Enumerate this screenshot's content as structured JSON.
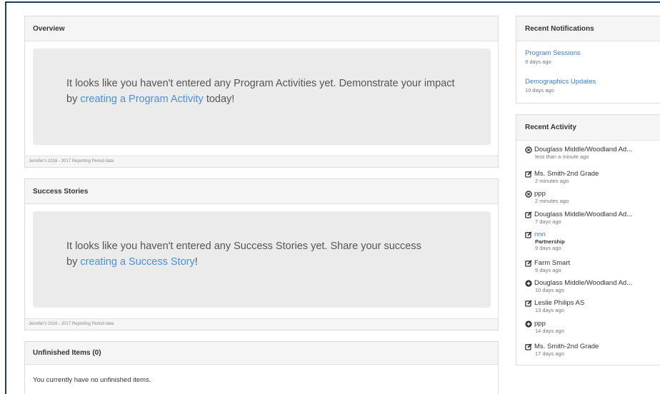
{
  "overview": {
    "title": "Overview",
    "empty_prefix": "It looks like you haven't entered any Program Activities yet. Demonstrate your impact by ",
    "empty_link": "creating a Program Activity",
    "empty_suffix": " today!",
    "footer": "Jennifer's 2016 - 2017 Reporting Period data"
  },
  "success": {
    "title": "Success Stories",
    "empty_prefix": "It looks like you haven't entered any Success Stories yet. Share your success by ",
    "empty_link": "creating a Success Story",
    "empty_suffix": "!",
    "footer": "Jennifer's 2016 - 2017 Reporting Period data"
  },
  "unfinished": {
    "title": "Unfinished Items (0)",
    "message": "You currently have no unfinished items."
  },
  "notifications": {
    "title": "Recent Notifications",
    "items": [
      {
        "title": "Program Sessions",
        "time": "9 days ago"
      },
      {
        "title": "Demographics Updates",
        "time": "10 days ago"
      }
    ]
  },
  "activity": {
    "title": "Recent Activity",
    "items": [
      {
        "icon": "circle-x-icon",
        "label": "Douglass Middle/Woodland Ad...",
        "time": "less than a minute ago"
      },
      {
        "icon": "edit-icon",
        "label": "Ms. Smith-2nd Grade",
        "time": "2 minutes ago"
      },
      {
        "icon": "circle-x-icon",
        "label": "ppp",
        "time": "2 minutes ago"
      },
      {
        "icon": "edit-icon",
        "label": "Douglass Middle/Woodland Ad...",
        "time": "7 days ago"
      },
      {
        "icon": "edit-icon",
        "label": "nnn",
        "sub": "Partnership",
        "time": "9 days ago"
      },
      {
        "icon": "edit-icon",
        "label": "Farm Smart",
        "time": "9 days ago"
      },
      {
        "icon": "plus-circle-icon",
        "label": "Douglass Middle/Woodland Ad...",
        "time": "10 days ago"
      },
      {
        "icon": "edit-icon",
        "label": "Leslie Philips AS",
        "time": "13 days ago"
      },
      {
        "icon": "plus-circle-icon",
        "label": "ppp",
        "time": "14 days ago"
      },
      {
        "icon": "edit-icon",
        "label": "Ms. Smith-2nd Grade",
        "time": "17 days ago"
      }
    ]
  }
}
